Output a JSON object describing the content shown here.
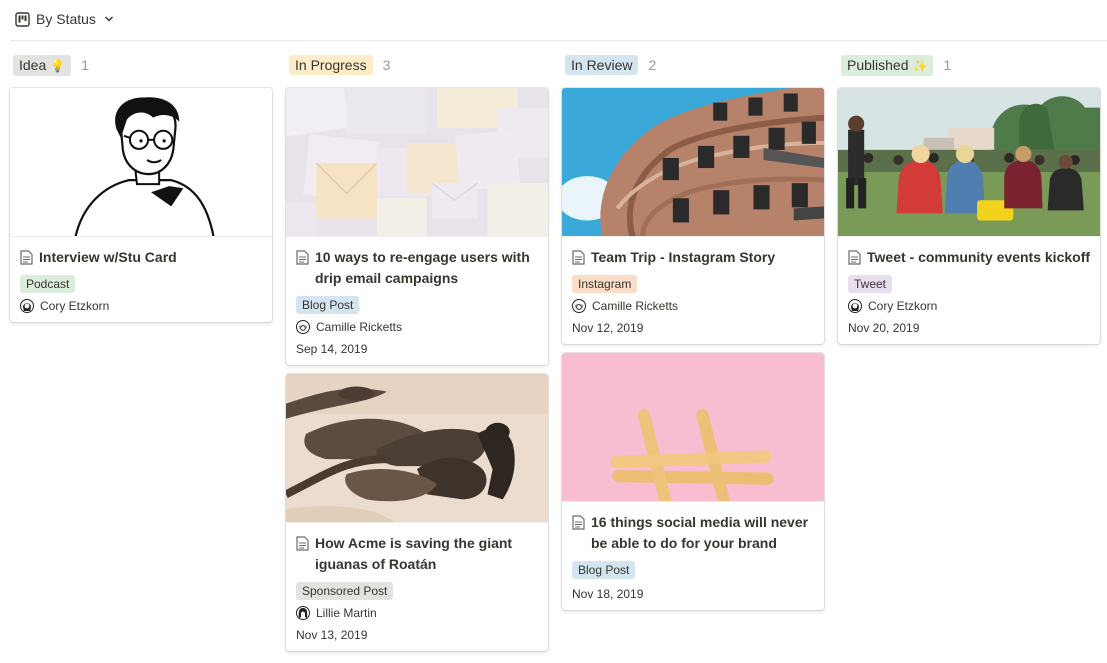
{
  "toolbar": {
    "view_label": "By Status",
    "icon": "board-icon"
  },
  "columns": [
    {
      "status": "Idea",
      "emoji": "💡",
      "count": "1",
      "pill_color": "#e3e2e0",
      "cards": [
        {
          "title": "Interview w/Stu Card",
          "tag": "Podcast",
          "tag_color": "#dbeddb",
          "person": "Cory Etzkorn"
        }
      ]
    },
    {
      "status": "In Progress",
      "emoji": "",
      "count": "3",
      "pill_color": "#fdecc8",
      "cards": [
        {
          "title": "10 ways to re-engage users with drip email campaigns",
          "tag": "Blog Post",
          "tag_color": "#d3e5ef",
          "person": "Camille Ricketts",
          "date": "Sep 14, 2019"
        },
        {
          "title": "How Acme is saving the giant iguanas of Roatán",
          "tag": "Sponsored Post",
          "tag_color": "#e3e2e0",
          "person": "Lillie Martin",
          "date": "Nov 13, 2019"
        }
      ]
    },
    {
      "status": "In Review",
      "emoji": "",
      "count": "2",
      "pill_color": "#d3e5ef",
      "cards": [
        {
          "title": "Team Trip - Instagram Story",
          "tag": "Instagram",
          "tag_color": "#fadec9",
          "person": "Camille Ricketts",
          "date": "Nov 12, 2019"
        },
        {
          "title": "16 things social media will never be able to do for your brand",
          "tag": "Blog Post",
          "tag_color": "#d3e5ef",
          "date": "Nov 18, 2019"
        }
      ]
    },
    {
      "status": "Published",
      "emoji": "✨",
      "count": "1",
      "pill_color": "#dbeddb",
      "cards": [
        {
          "title": "Tweet - community events kickoff",
          "tag": "Tweet",
          "tag_color": "#e8deee",
          "person": "Cory Etzkorn",
          "date": "Nov 20, 2019"
        }
      ]
    }
  ]
}
